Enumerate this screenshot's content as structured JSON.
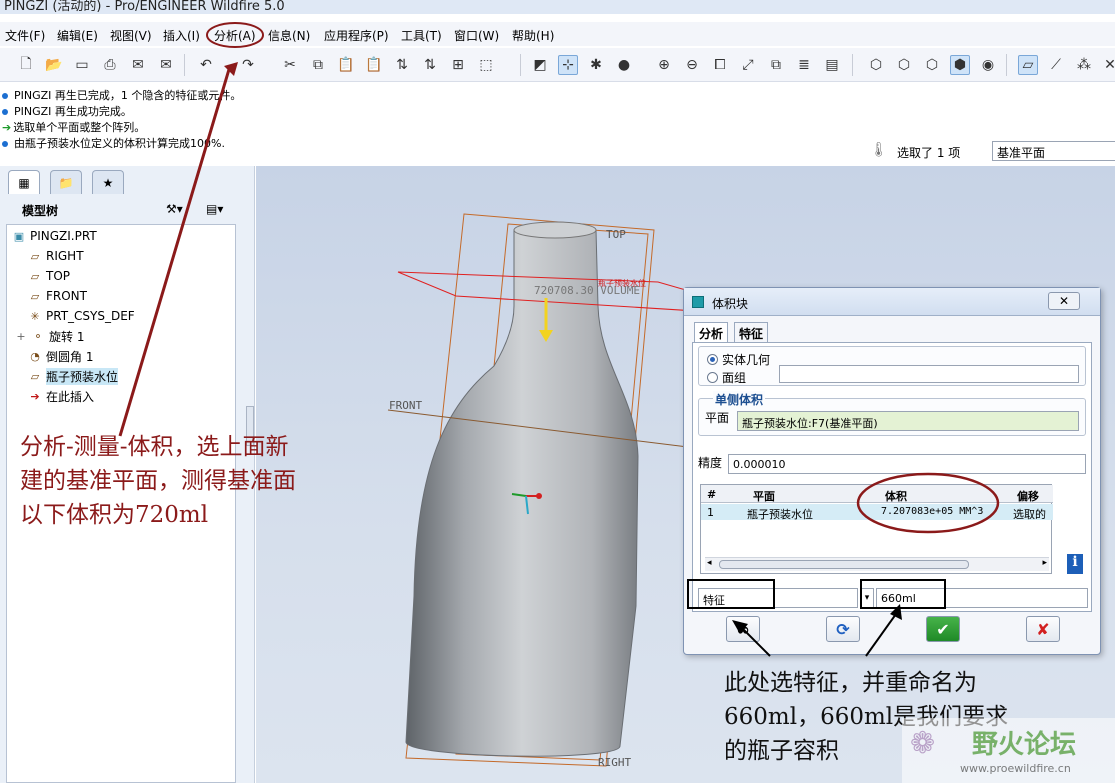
{
  "window": {
    "title": "PINGZI (活动的) - Pro/ENGINEER Wildfire 5.0"
  },
  "menu": [
    "文件(F)",
    "编辑(E)",
    "视图(V)",
    "插入(I)",
    "分析(A)",
    "信息(N)",
    "应用程序(P)",
    "工具(T)",
    "窗口(W)",
    "帮助(H)"
  ],
  "messages": [
    "PINGZI 再生已完成，1 个隐含的特征或元件。",
    "PINGZI 再生成功完成。",
    "选取单个平面或整个阵列。",
    "由瓶子预装水位定义的体积计算完成100%."
  ],
  "selection": {
    "count_label": "选取了 1 项",
    "filter_value": "基准平面"
  },
  "model_tree": {
    "title": "模型树",
    "root": "PINGZI.PRT",
    "nodes": [
      "RIGHT",
      "TOP",
      "FRONT",
      "PRT_CSYS_DEF",
      "旋转 1",
      "倒圆角 1",
      "瓶子预装水位",
      "在此插入"
    ]
  },
  "viewport": {
    "labels": {
      "top": "TOP",
      "front": "FRONT",
      "right": "RIGHT",
      "plane": "瓶子预装水位",
      "volume": "720708.30 VOLUME"
    }
  },
  "dialog": {
    "title": "体积块",
    "tabs": [
      "分析",
      "特征"
    ],
    "radio_solid": "实体几何",
    "radio_quilt": "面组",
    "group_label": "单侧体积",
    "plane_label": "平面",
    "plane_value": "瓶子预装水位:F7(基准平面)",
    "precision_label": "精度",
    "precision_value": "0.000010",
    "table": {
      "headers": [
        "#",
        "平面",
        "体积",
        "偏移"
      ],
      "row": [
        "1",
        "瓶子预装水位",
        "7.207083e+05 MM^3",
        "选取的"
      ]
    },
    "type_value": "特征",
    "name_value": "660ml"
  },
  "annotations": {
    "left": [
      "分析-测量-体积，选上面新",
      "建的基准平面，测得基准面",
      "以下体积为720ml"
    ],
    "right": [
      "此处选特征，并重命名为",
      "660ml，660ml是我们要求",
      "的瓶子容积"
    ]
  },
  "watermark": {
    "name": "野火论坛",
    "url": "www.proewildfire.cn"
  },
  "colors": {
    "annotation": "#8b1a1a",
    "plane_line": "#e02020",
    "accent": "#2c63b8"
  }
}
